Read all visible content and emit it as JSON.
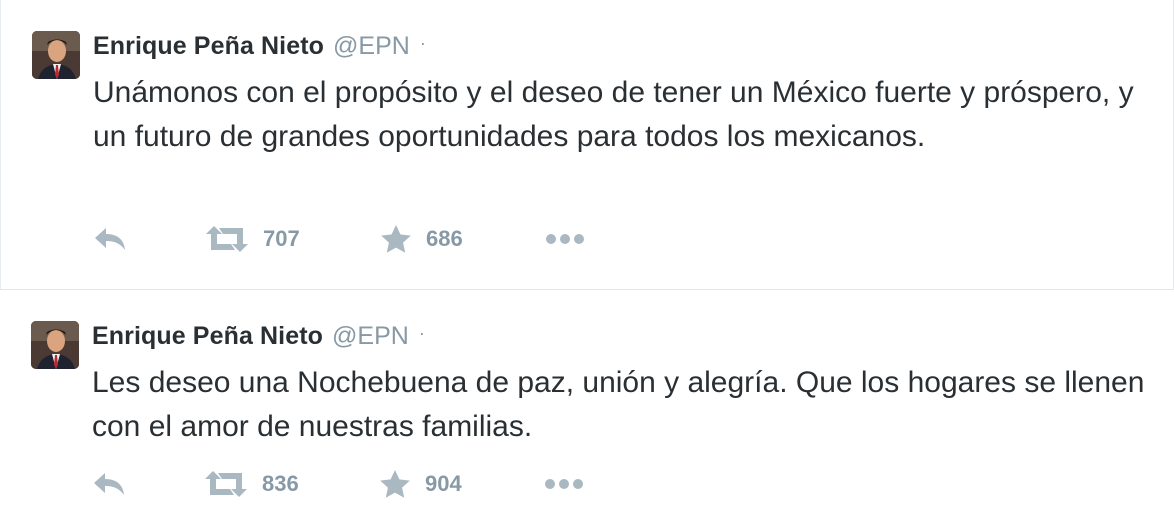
{
  "tweets": [
    {
      "fullname": "Enrique Peña Nieto",
      "username": "@EPN",
      "separator": "·",
      "text": "Unámonos con el propósito y el deseo de tener un México fuerte y próspero, y un futuro de grandes oportunidades para todos los mexicanos.",
      "retweets": "707",
      "favorites": "686"
    },
    {
      "fullname": "Enrique Peña Nieto",
      "username": "@EPN",
      "separator": "·",
      "text": "Les deseo una Nochebuena de paz, unión y alegría. Que los hogares se llenen con el amor de nuestras familias.",
      "retweets": "836",
      "favorites": "904"
    }
  ],
  "icons": {
    "reply": "reply-icon",
    "retweet": "retweet-icon",
    "favorite": "star-icon",
    "more": "more-dots-icon"
  },
  "colors": {
    "text": "#292f33",
    "muted": "#8899a6",
    "icon": "#aab8c2",
    "divider": "#e1e8ed"
  }
}
